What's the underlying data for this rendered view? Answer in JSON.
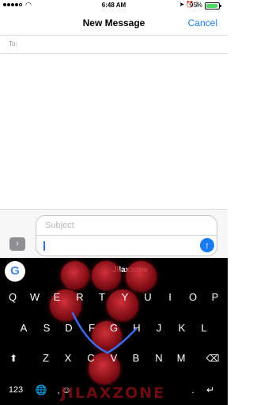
{
  "status_bar": {
    "time": "6:48 AM",
    "battery_percent": "95%",
    "battery_level": 0.95,
    "signal_bars_filled": 4,
    "signal_bars_total": 5
  },
  "nav": {
    "title": "New Message",
    "cancel_label": "Cancel"
  },
  "recipients": {
    "to_label": "To:"
  },
  "compose": {
    "subject_placeholder": "Subject",
    "message_value": ""
  },
  "keyboard": {
    "suggestion": "Jilaxzone",
    "row1": [
      "Q",
      "W",
      "E",
      "R",
      "T",
      "Y",
      "U",
      "I",
      "O",
      "P"
    ],
    "row2": [
      "A",
      "S",
      "D",
      "F",
      "G",
      "H",
      "J",
      "K",
      "L"
    ],
    "row3": [
      "Z",
      "X",
      "C",
      "V",
      "B",
      "N",
      "M"
    ],
    "numbers_label": "123",
    "comma_label": ",",
    "period_label": ".",
    "watermark": "JILAXZONE"
  },
  "colors": {
    "accent": "#1a7cf5",
    "keyboard_bg": "#000000",
    "bubble": "#c8232f"
  },
  "icons": [
    "google-g-icon",
    "expand-icon",
    "send-arrow-icon",
    "shift-icon",
    "backspace-icon",
    "globe-icon",
    "emoji-icon",
    "return-icon"
  ]
}
